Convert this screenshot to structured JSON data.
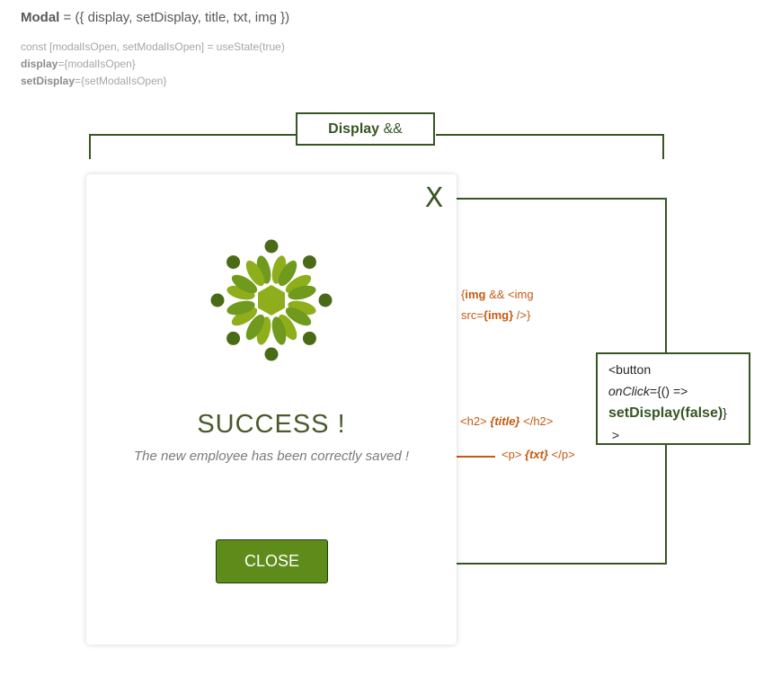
{
  "header": {
    "name": "Modal",
    "signature": " = ({ display, setDisplay, title, txt, img })"
  },
  "code": {
    "line1": "const [modalIsOpen, setModalIsOpen] = useState(true)",
    "line2_key": "display",
    "line2_val": "={modalIsOpen}",
    "line3_key": "setDisplay",
    "line3_val": "={setModalIsOpen}"
  },
  "condition": {
    "bold": "Display",
    "rest": " &&"
  },
  "modal": {
    "close_glyph": "X",
    "logo_icon": "mandala-logo-icon",
    "title": "SUCCESS !",
    "text": "The new employee has been correctly saved !",
    "button_label": "CLOSE"
  },
  "annotations": {
    "img_line1_a": "{",
    "img_line1_b": "img",
    "img_line1_c": " && <img",
    "img_line2_a": "src=",
    "img_line2_b": "{img}",
    "img_line2_c": " />}",
    "title_a": "<h2> ",
    "title_b": "{title}",
    "title_c": " </h2>",
    "txt_a": "<p> ",
    "txt_b": "{txt}",
    "txt_c": " </p>"
  },
  "button_note": {
    "line1": "<button",
    "line2_italic": "onClick",
    "line2_rest": "={() =>",
    "line3": "setDisplay(false)",
    "line3_rest": "}",
    "line4": " >"
  },
  "colors": {
    "dark_green": "#375623",
    "button_green": "#5e8b1a",
    "annotation_orange": "#c55a11"
  }
}
